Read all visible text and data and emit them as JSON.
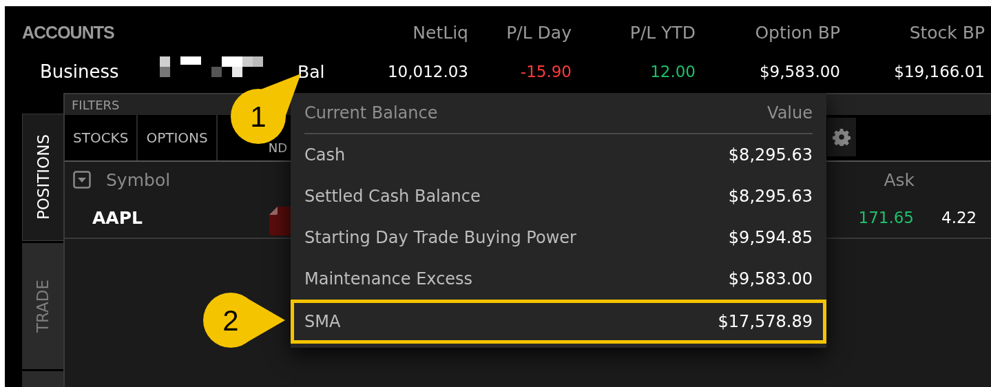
{
  "accounts": {
    "title": "ACCOUNTS",
    "columns": [
      "NetLiq",
      "P/L Day",
      "P/L YTD",
      "Option BP",
      "Stock BP"
    ],
    "rows": [
      {
        "name": "Business",
        "type_label": "Bal",
        "values": [
          {
            "text": "10,012.03",
            "color": "#ffffff"
          },
          {
            "text": "-15.90",
            "color": "#ff3b3b"
          },
          {
            "text": "12.00",
            "color": "#1fbf6a"
          },
          {
            "text": "$9,583.00",
            "color": "#ffffff"
          },
          {
            "text": "$19,166.01",
            "color": "#ffffff"
          }
        ]
      }
    ]
  },
  "side_tabs": [
    {
      "label": "POSITIONS",
      "selected": true
    },
    {
      "label": "TRADE",
      "selected": false
    },
    {
      "selected": false
    }
  ],
  "filters": {
    "label": "FILTERS",
    "buttons": [
      {
        "label": "STOCKS"
      },
      {
        "label": "OPTIONS"
      },
      {
        "label": "ND"
      }
    ]
  },
  "table": {
    "columns": [
      "Symbol",
      "Ask"
    ],
    "rows": [
      {
        "symbol": "AAPL",
        "ask": "171.65",
        "column_3": "4.22"
      }
    ]
  },
  "balance_popup": {
    "columns": [
      "Current Balance",
      "Value"
    ],
    "rows": [
      {
        "label": "Cash",
        "value": "$8,295.63",
        "highlighted": false
      },
      {
        "label": "Settled Cash Balance",
        "value": "$8,295.63",
        "highlighted": false
      },
      {
        "label": "Starting Day Trade Buying Power",
        "value": "$9,594.85",
        "highlighted": false
      },
      {
        "label": "Maintenance Excess",
        "value": "$9,583.00",
        "highlighted": false
      },
      {
        "label": "SMA",
        "value": "$17,578.89",
        "highlighted": true
      }
    ]
  },
  "callouts": [
    {
      "number": "1"
    },
    {
      "number": "2"
    }
  ]
}
